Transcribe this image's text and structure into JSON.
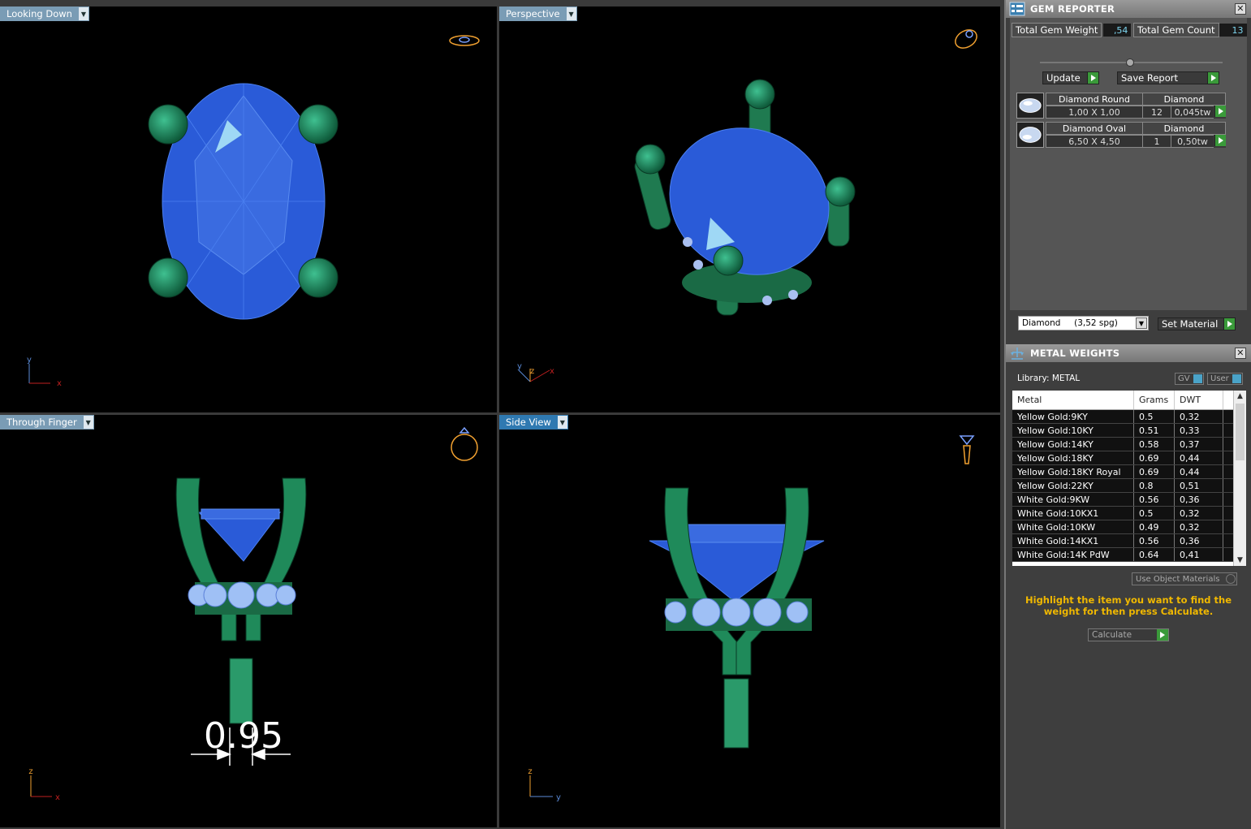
{
  "viewports": {
    "top_left": {
      "title": "Looking Down"
    },
    "top_right": {
      "title": "Perspective"
    },
    "bottom_left": {
      "title": "Through Finger",
      "measurement": "0.95"
    },
    "bottom_right": {
      "title": "Side View"
    }
  },
  "axes": {
    "x": "x",
    "y": "y",
    "z": "z"
  },
  "gem_reporter": {
    "title": "GEM REPORTER",
    "total_weight_label": "Total Gem Weight",
    "total_weight_value": ",54",
    "total_count_label": "Total Gem Count",
    "total_count_value": "13",
    "update_label": "Update",
    "save_report_label": "Save Report",
    "rows": [
      {
        "name": "Diamond Round",
        "material": "Diamond",
        "size": "1,00 X 1,00",
        "count": "12",
        "weight": "0,045tw"
      },
      {
        "name": "Diamond Oval",
        "material": "Diamond",
        "size": "6,50 X 4,50",
        "count": "1",
        "weight": "0,50tw"
      }
    ],
    "material_selected": "Diamond     (3,52 spg)",
    "set_material_label": "Set Material"
  },
  "metal_weights": {
    "title": "METAL WEIGHTS",
    "library_label": "Library: METAL",
    "gv_label": "GV",
    "user_label": "User",
    "columns": [
      "Metal",
      "Grams",
      "DWT"
    ],
    "rows": [
      {
        "metal": "Yellow Gold:9KY",
        "grams": "0.5",
        "dwt": "0,32"
      },
      {
        "metal": "Yellow Gold:10KY",
        "grams": "0.51",
        "dwt": "0,33"
      },
      {
        "metal": "Yellow Gold:14KY",
        "grams": "0.58",
        "dwt": "0,37"
      },
      {
        "metal": "Yellow Gold:18KY",
        "grams": "0.69",
        "dwt": "0,44"
      },
      {
        "metal": "Yellow Gold:18KY Royal",
        "grams": "0.69",
        "dwt": "0,44"
      },
      {
        "metal": "Yellow Gold:22KY",
        "grams": "0.8",
        "dwt": "0,51"
      },
      {
        "metal": "White Gold:9KW",
        "grams": "0.56",
        "dwt": "0,36"
      },
      {
        "metal": "White Gold:10KX1",
        "grams": "0.5",
        "dwt": "0,32"
      },
      {
        "metal": "White Gold:10KW",
        "grams": "0.49",
        "dwt": "0,32"
      },
      {
        "metal": "White Gold:14KX1",
        "grams": "0.56",
        "dwt": "0,36"
      },
      {
        "metal": "White Gold:14K PdW",
        "grams": "0.64",
        "dwt": "0,41"
      }
    ],
    "use_object_materials_label": "Use Object Materials",
    "hint": "Highlight the item you want to find the weight for then press Calculate.",
    "calculate_label": "Calculate"
  },
  "colors": {
    "gem_blue": "#2a5bd8",
    "gem_light": "#9fd8f5",
    "metal_green": "#1f8a5a",
    "header_blue": "#7a9cb5",
    "active_header": "#2f79b1",
    "ring_orange": "#f0a030",
    "hint_yellow": "#f0b800"
  }
}
